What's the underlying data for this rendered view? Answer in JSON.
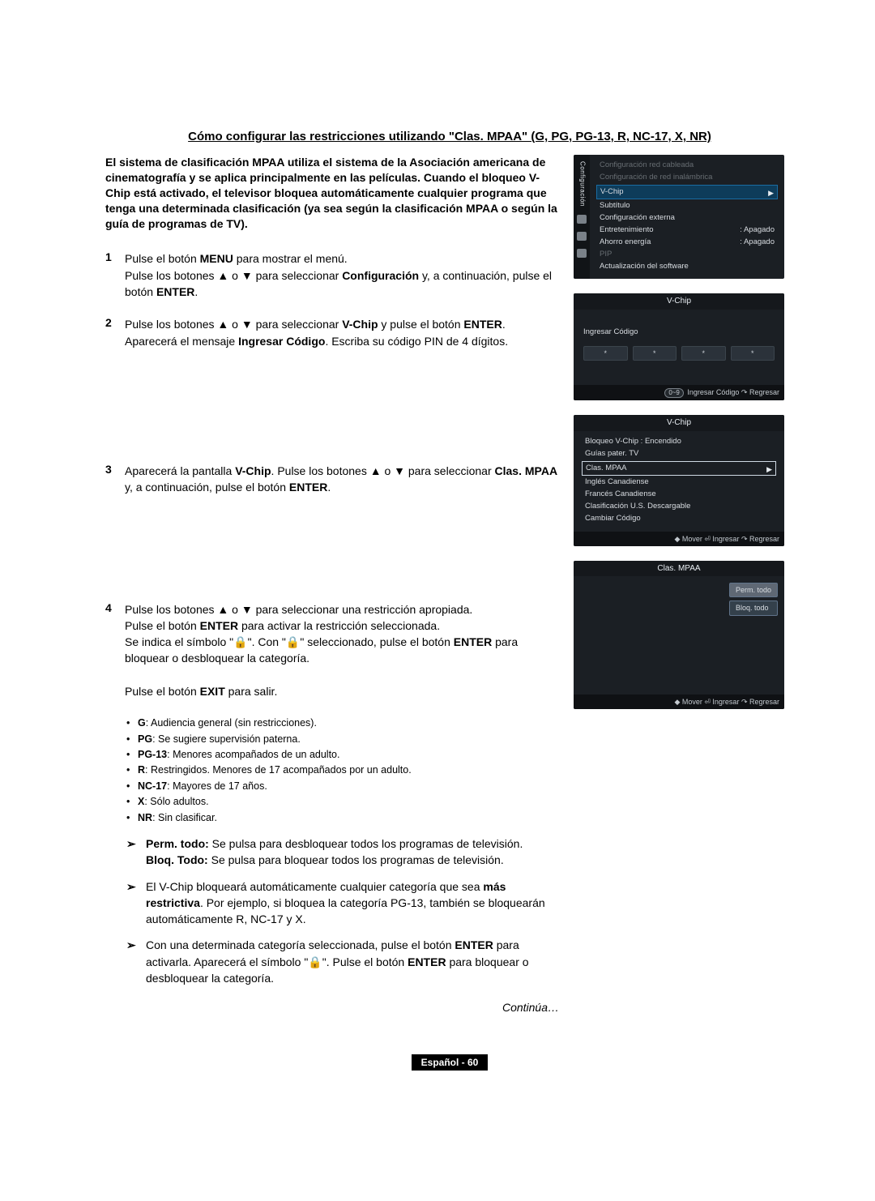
{
  "title": "Cómo configurar las restricciones utilizando \"Clas. MPAA\" (G, PG, PG-13, R, NC-17, X, NR)",
  "intro": "El sistema de clasificación MPAA utiliza el sistema de la Asociación americana de cinematografía y se aplica principalmente en las películas. Cuando el bloqueo V-Chip está activado, el televisor bloquea automáticamente cualquier programa que tenga una determinada clasificación (ya sea según la clasificación MPAA o según la guía de programas de TV).",
  "steps": {
    "s1": {
      "num": "1",
      "l1_a": "Pulse el botón ",
      "l1_b": "MENU",
      "l1_c": " para mostrar el menú.",
      "l2_a": "Pulse los botones ▲ o ▼ para seleccionar ",
      "l2_b": "Configuración",
      "l2_c": " y, a continuación, pulse el botón ",
      "l2_d": "ENTER",
      "l2_e": "."
    },
    "s2": {
      "num": "2",
      "l1_a": "Pulse los botones ▲ o ▼ para seleccionar ",
      "l1_b": "V-Chip",
      "l1_c": " y pulse el botón ",
      "l1_d": "ENTER",
      "l1_e": ".",
      "l2_a": "Aparecerá el mensaje ",
      "l2_b": "Ingresar Código",
      "l2_c": ". Escriba su código PIN de 4 dígitos."
    },
    "s3": {
      "num": "3",
      "l1_a": "Aparecerá la pantalla  ",
      "l1_b": "V-Chip",
      "l1_c": ". Pulse los botones ▲ o ▼ para seleccionar ",
      "l1_d": "Clas. MPAA",
      "l1_e": " y, a continuación, pulse el botón ",
      "l1_f": "ENTER",
      "l1_g": "."
    },
    "s4": {
      "num": "4",
      "l1": "Pulse los botones ▲ o ▼ para seleccionar una restricción apropiada.",
      "l2_a": "Pulse el botón ",
      "l2_b": "ENTER",
      "l2_c": " para activar la restricción seleccionada.",
      "l3_a": "Se indica el símbolo \"",
      "l3_lock": "🔒",
      "l3_b": "\". Con \"",
      "l3_c": "\" seleccionado, pulse el botón ",
      "l3_d": "ENTER",
      "l3_e": " para bloquear o desbloquear la categoría.",
      "l4_a": "Pulse el botón ",
      "l4_b": "EXIT",
      "l4_c": " para salir."
    }
  },
  "ratings": [
    {
      "code": "G",
      "desc": ": Audiencia general (sin restricciones)."
    },
    {
      "code": "PG",
      "desc": ": Se sugiere supervisión paterna."
    },
    {
      "code": "PG-13",
      "desc": ": Menores acompañados de un adulto."
    },
    {
      "code": "R",
      "desc": ": Restringidos. Menores de 17 acompañados por un adulto."
    },
    {
      "code": "NC-17",
      "desc": ": Mayores de 17 años."
    },
    {
      "code": "X",
      "desc": ": Sólo adultos."
    },
    {
      "code": "NR",
      "desc": ": Sin clasificar."
    }
  ],
  "arrows": {
    "a1_a": "Perm. todo:",
    "a1_b": " Se pulsa para desbloquear todos los programas de televisión.",
    "a1_c": "Bloq. Todo:",
    "a1_d": " Se pulsa para bloquear todos los programas de televisión.",
    "a2_a": "El V-Chip bloqueará automáticamente cualquier categoría que sea ",
    "a2_b": "más restrictiva",
    "a2_c": ". Por ejemplo, si bloquea la categoría PG-13, también se bloquearán automáticamente R, NC-17 y X.",
    "a3_a": "Con una determinada categoría seleccionada, pulse el botón ",
    "a3_b": "ENTER",
    "a3_c": " para activarla. Aparecerá el símbolo \"",
    "a3_lock": "🔒",
    "a3_d": "\". Pulse el botón ",
    "a3_e": "ENTER",
    "a3_f": " para bloquear o desbloquear la categoría."
  },
  "arrow_glyph": "➢",
  "continua": "Continúa…",
  "footer": {
    "lang": "Español - ",
    "page": "60"
  },
  "osd": {
    "config": {
      "side_label": "Configuración",
      "items": {
        "wired": "Configuración red cableada",
        "wireless": "Configuración de red inalámbrica",
        "vchip": "V-Chip",
        "subtitle": "Subtítulo",
        "ext": "Configuración externa",
        "ent_k": "Entretenimiento",
        "ent_v": ": Apagado",
        "eco_k": "Ahorro energía",
        "eco_v": ": Apagado",
        "pip": "PIP",
        "sw": "Actualización del software"
      },
      "tri": "▶"
    },
    "pin": {
      "title": "V-Chip",
      "label": "Ingresar Código",
      "star": "*",
      "footer_code_pill": "0~9",
      "footer_code": " Ingresar Código   ↷ Regresar"
    },
    "vchip": {
      "title": "V-Chip",
      "items": {
        "lock_k": "Bloqueo V-Chip",
        "lock_v": ": Encendido",
        "guias": "Guías pater. TV",
        "mpaa": "Clas. MPAA",
        "en": "Inglés Canadiense",
        "fr": "Francés Canadiense",
        "us": "Clasificación U.S. Descargable",
        "code": "Cambiar Código"
      },
      "tri": "▶",
      "footer": "◆ Mover      ⏎ Ingresar   ↷ Regresar"
    },
    "mpaa": {
      "title": "Clas. MPAA",
      "perm": "Perm. todo",
      "bloq": "Bloq. todo",
      "footer": "◆ Mover      ⏎ Ingresar   ↷ Regresar"
    }
  }
}
